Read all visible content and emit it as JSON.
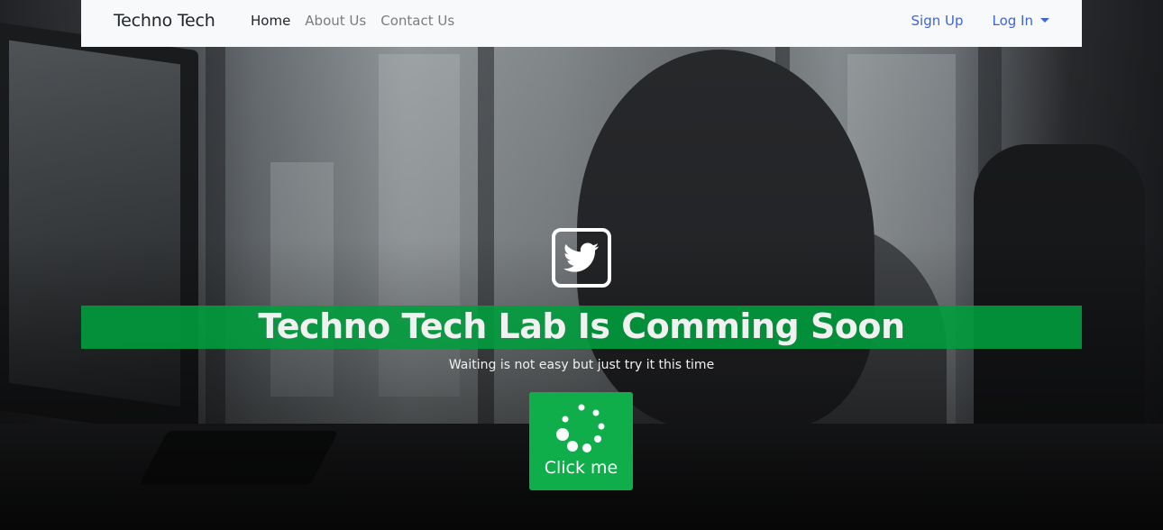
{
  "navbar": {
    "brand": "Techno Tech",
    "links": [
      {
        "label": "Home",
        "active": true
      },
      {
        "label": "About Us",
        "active": false
      },
      {
        "label": "Contact Us",
        "active": false
      }
    ],
    "right_links": [
      {
        "label": "Sign Up"
      },
      {
        "label": "Log In",
        "dropdown": true
      }
    ]
  },
  "hero": {
    "social_icon": "twitter-icon",
    "title": "Techno Tech Lab Is Comming Soon",
    "subtitle": "Waiting is not easy but just try it this time",
    "button_label": "Click me",
    "button_icon": "loading-spinner-icon"
  },
  "colors": {
    "navbar_bg": "#f8f9fa",
    "banner_green": "#009e3e",
    "button_green": "#0fae4a",
    "link_blue": "#3f64d8",
    "muted_link": "#7a7d80"
  }
}
